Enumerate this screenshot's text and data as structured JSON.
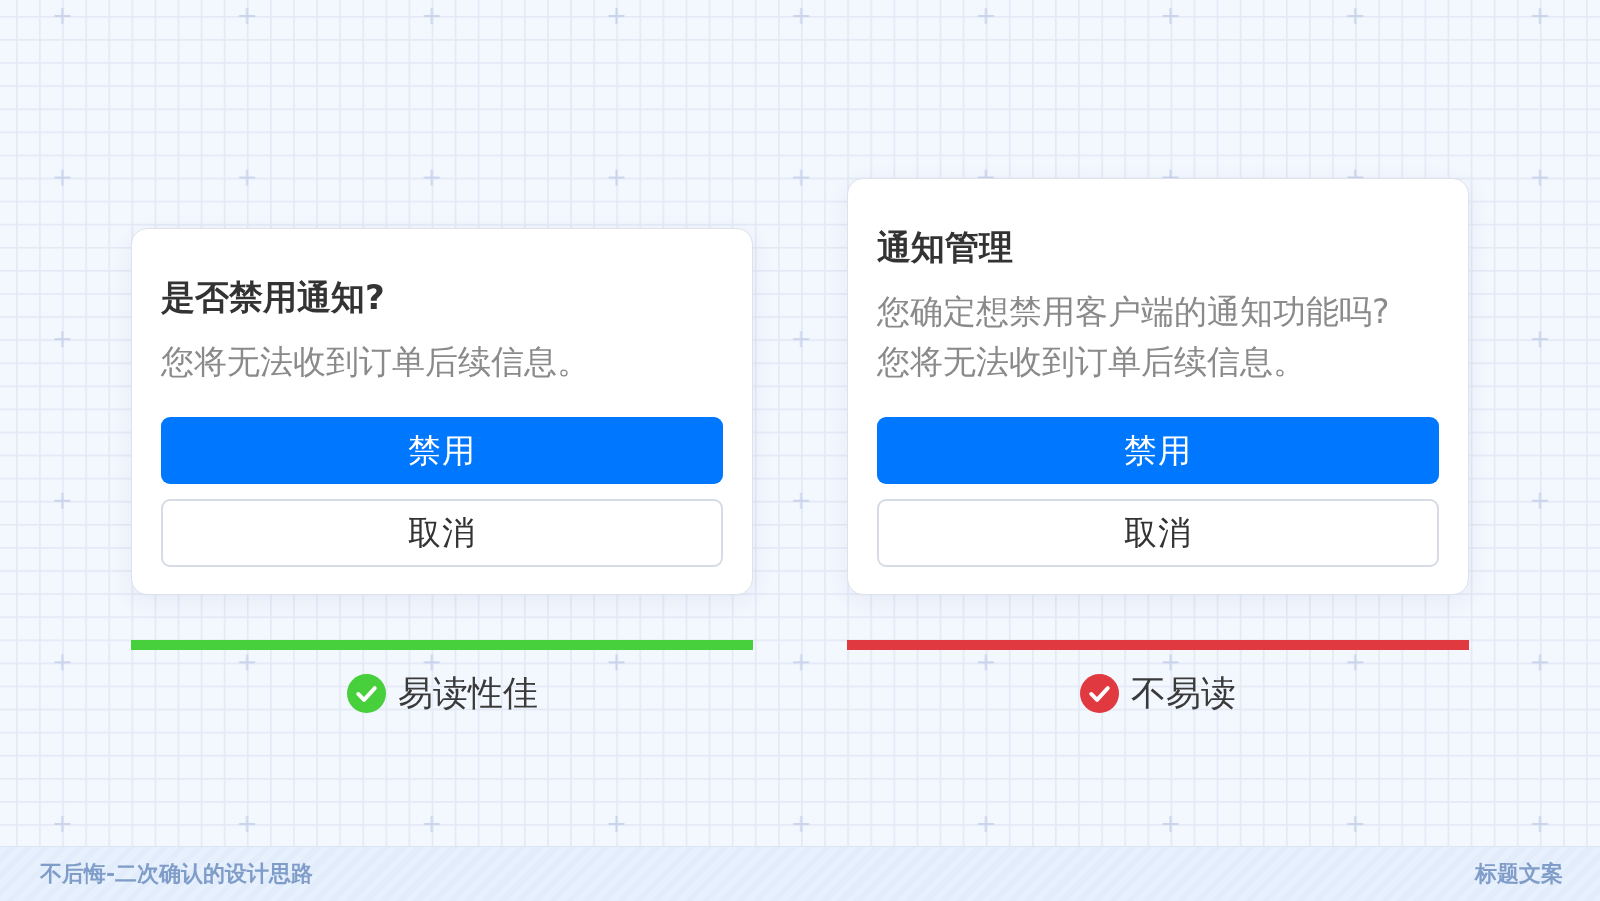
{
  "examples": [
    {
      "dialog": {
        "title": "是否禁用通知?",
        "message": [
          "您将无法收到订单后续信息。"
        ],
        "buttons": [
          {
            "label": "禁用",
            "kind": "primary"
          },
          {
            "label": "取消",
            "kind": "secondary"
          }
        ]
      },
      "verdict": {
        "label": "易读性佳",
        "color": "#47d03b"
      }
    },
    {
      "dialog": {
        "title": "通知管理",
        "message": [
          "您确定想禁用客户端的通知功能吗?",
          "您将无法收到订单后续信息。"
        ],
        "buttons": [
          {
            "label": "禁用",
            "kind": "primary"
          },
          {
            "label": "取消",
            "kind": "secondary"
          }
        ]
      },
      "verdict": {
        "label": "不易读",
        "color": "#e0393f"
      }
    }
  ],
  "footer": {
    "title": "不后悔-二次确认的设计思路",
    "caption": "标题文案"
  }
}
